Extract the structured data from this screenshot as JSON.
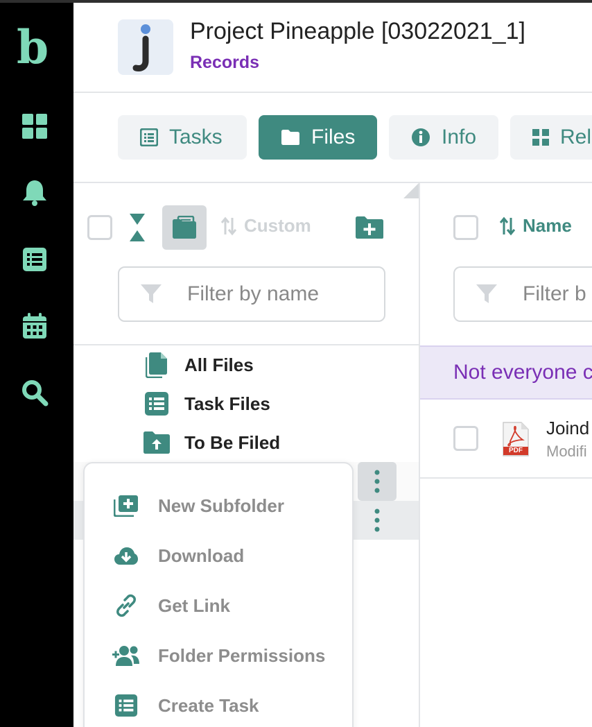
{
  "nav": {
    "logo": "b",
    "items": [
      {
        "icon": "dashboard-grid-icon"
      },
      {
        "icon": "bell-icon"
      },
      {
        "icon": "list-icon"
      },
      {
        "icon": "calendar-icon"
      },
      {
        "icon": "search-icon"
      }
    ]
  },
  "header": {
    "app_badge_letter": "j",
    "title": "Project Pineapple [03022021_1]",
    "subtitle": "Records"
  },
  "tabs": [
    {
      "label": "Tasks",
      "icon": "list-icon",
      "active": false
    },
    {
      "label": "Files",
      "icon": "folder-icon",
      "active": true
    },
    {
      "label": "Info",
      "icon": "info-icon",
      "active": false
    },
    {
      "label": "Rel",
      "icon": "grid-icon",
      "active": false
    }
  ],
  "folder_panel": {
    "sort_label": "Custom",
    "filter_placeholder": "Filter by name",
    "folders": [
      {
        "label": "All Files",
        "icon": "file-stack-icon"
      },
      {
        "label": "Task Files",
        "icon": "list-icon"
      },
      {
        "label": "To Be Filed",
        "icon": "folder-upload-icon"
      }
    ]
  },
  "context_menu": {
    "items": [
      {
        "label": "New Subfolder",
        "icon": "add-folder-icon"
      },
      {
        "label": "Download",
        "icon": "cloud-download-icon"
      },
      {
        "label": "Get Link",
        "icon": "link-icon"
      },
      {
        "label": "Folder Permissions",
        "icon": "add-users-icon"
      },
      {
        "label": "Create Task",
        "icon": "list-icon"
      }
    ]
  },
  "file_panel": {
    "sort_label": "Name",
    "filter_placeholder": "Filter b",
    "banner_text": "Not everyone c",
    "files": [
      {
        "name": "Joind",
        "meta": "Modifi",
        "type_badge": "PDF"
      }
    ]
  },
  "colors": {
    "accent": "#3f8a80",
    "rail_icon": "#7fd9b8",
    "purple": "#7a2fb5",
    "banner_bg": "#ece8f7"
  }
}
